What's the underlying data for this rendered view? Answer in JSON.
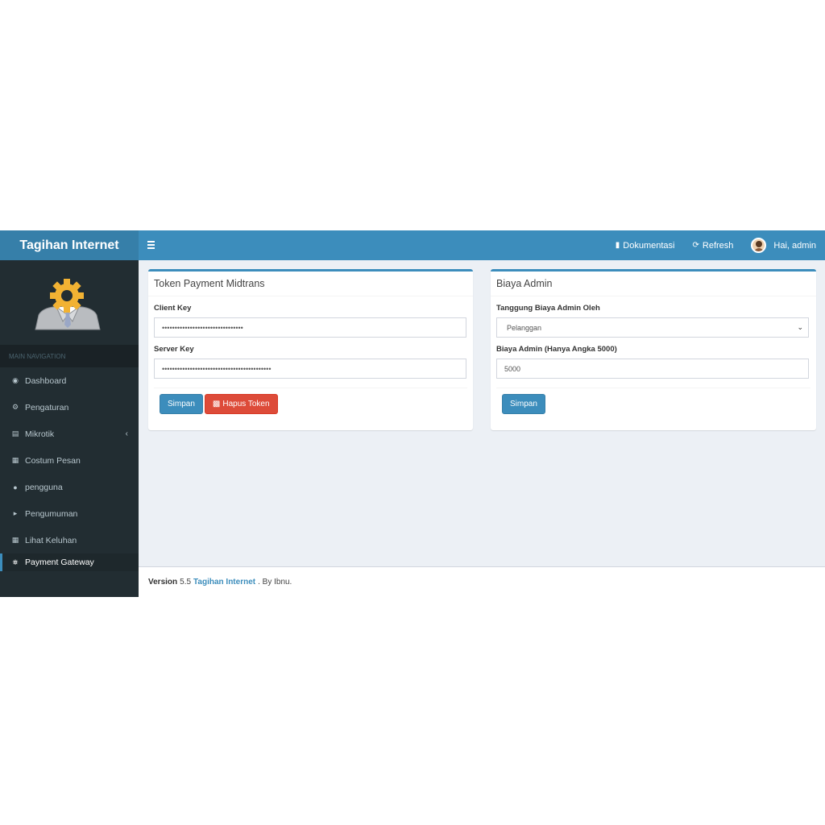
{
  "header": {
    "logo": "Tagihan Internet",
    "docs_label": "Dokumentasi",
    "refresh_label": "Refresh",
    "user_label": "Hai, admin"
  },
  "sidebar": {
    "nav_header": "MAIN NAVIGATION",
    "items": [
      {
        "label": "Dashboard",
        "icon": "dashboard-icon"
      },
      {
        "label": "Pengaturan",
        "icon": "gear-icon"
      },
      {
        "label": "Mikrotik",
        "icon": "server-icon"
      },
      {
        "label": "Costum Pesan",
        "icon": "file-icon"
      },
      {
        "label": "pengguna",
        "icon": "users-icon"
      },
      {
        "label": "Pengumuman",
        "icon": "volume-icon"
      },
      {
        "label": "Lihat Keluhan",
        "icon": "file-icon"
      },
      {
        "label": "Payment Gateway",
        "icon": "bank-icon"
      }
    ]
  },
  "token_box": {
    "title": "Token Payment Midtrans",
    "client_key_label": "Client Key",
    "client_key_value": "••••••••••••••••••••••••••••••••",
    "server_key_label": "Server Key",
    "server_key_value": "•••••••••••••••••••••••••••••••••••••••••••",
    "save_label": "Simpan",
    "delete_label": "Hapus Token"
  },
  "admin_box": {
    "title": "Biaya Admin",
    "bearer_label": "Tanggung Biaya Admin Oleh",
    "bearer_value": "Pelanggan",
    "fee_label": "Biaya Admin (Hanya Angka 5000)",
    "fee_value": "5000",
    "save_label": "Simpan"
  },
  "footer": {
    "version_label": "Version",
    "version_number": "5.5",
    "app_name": "Tagihan Internet",
    "suffix": ". By Ibnu."
  },
  "colors": {
    "primary": "#3c8dbc",
    "danger": "#dd4b39",
    "sidebar": "#222d32"
  }
}
